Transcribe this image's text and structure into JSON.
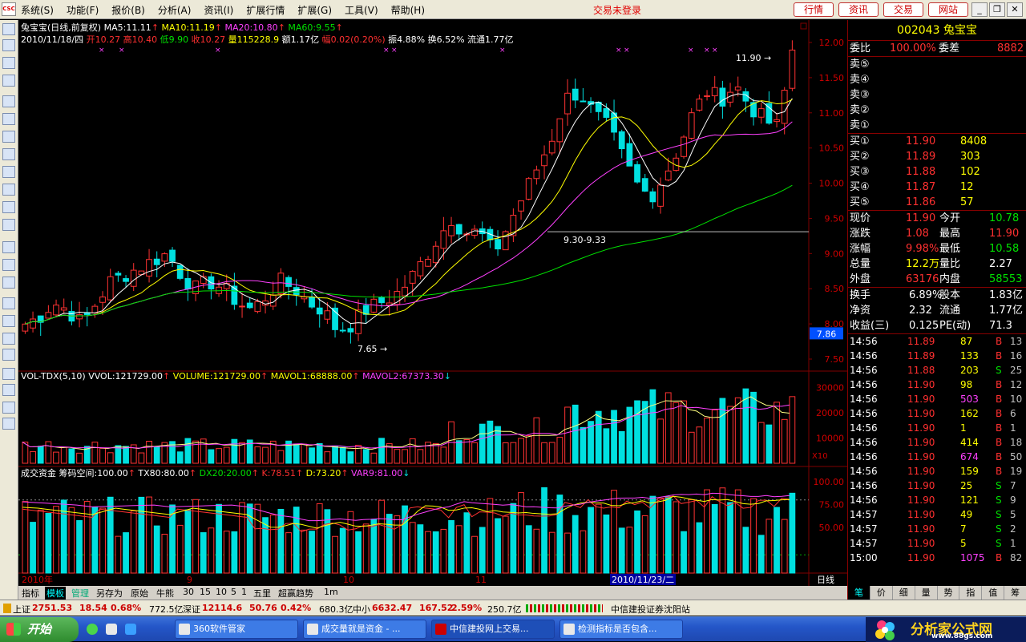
{
  "menubar": {
    "logo": "CSC",
    "items": [
      "系统(S)",
      "功能(F)",
      "报价(B)",
      "分析(A)",
      "资讯(I)",
      "扩展行情",
      "扩展(G)",
      "工具(V)",
      "帮助(H)"
    ],
    "center_text": "交易未登录",
    "buttons": [
      "行情",
      "资讯",
      "交易",
      "网站"
    ]
  },
  "main_chart": {
    "info_line1": {
      "stock": "兔宝宝(日线,前复权)",
      "ma5": "MA5:11.11",
      "ma10": "MA10:11.19",
      "ma20": "MA20:10.80",
      "ma60": "MA60:9.55"
    },
    "info_line2": {
      "date": "2010/11/18/四",
      "open": "开10.27",
      "high": "高10.40",
      "low": "低9.90",
      "close": "收10.27",
      "vol": "量115228.9",
      "amt": "额1.17亿",
      "chg": "幅0.02(0.20%)",
      "amp": "振4.88%",
      "turn": "换6.52%",
      "float": "流通1.77亿"
    },
    "annotations": {
      "high_label": "11.90",
      "low_label": "7.65",
      "line_label": "9.30-9.33",
      "price_tag": "7.86"
    },
    "y_labels": [
      "12.00",
      "11.50",
      "11.00",
      "10.50",
      "10.00",
      "9.50",
      "9.00",
      "8.50",
      "8.00",
      "7.50"
    ]
  },
  "vol_panel": {
    "title": "VOL-TDX(5,10)",
    "vvol": "VVOL:121729.00",
    "volume": "VOLUME:121729.00",
    "mavol1": "MAVOL1:68888.00",
    "mavol2": "MAVOL2:67373.30",
    "y_labels": [
      "30000",
      "20000",
      "10000"
    ],
    "scale": "X10"
  },
  "ind_panel": {
    "title": "成交资金",
    "p1": "筹码空间:100.00",
    "tx": "TX80:80.00",
    "dx": "DX20:20.00",
    "k": "K:78.51",
    "d": "D:73.20",
    "var9": "VAR9:81.00",
    "y_labels": [
      "100.00",
      "75.00",
      "50.00"
    ]
  },
  "x_axis": {
    "labels": [
      "2010年",
      "9",
      "10",
      "11"
    ],
    "cursor": "2010/11/23/二",
    "period": "日线"
  },
  "bottom_tabs": [
    "指标",
    "模板",
    "管理",
    "另存为",
    "原始",
    "牛熊",
    "30",
    "15",
    "10",
    "5",
    "1",
    "五里",
    "超赢趋势",
    "1m"
  ],
  "right_panel": {
    "code": "002043",
    "name": "兔宝宝",
    "weibi_label": "委比",
    "weibi": "100.00%",
    "weicha_label": "委差",
    "weicha": "8882",
    "sell": [
      {
        "label": "卖⑤",
        "price": "",
        "vol": ""
      },
      {
        "label": "卖④",
        "price": "",
        "vol": ""
      },
      {
        "label": "卖③",
        "price": "",
        "vol": ""
      },
      {
        "label": "卖②",
        "price": "",
        "vol": ""
      },
      {
        "label": "卖①",
        "price": "",
        "vol": ""
      }
    ],
    "buy": [
      {
        "label": "买①",
        "price": "11.90",
        "vol": "8408"
      },
      {
        "label": "买②",
        "price": "11.89",
        "vol": "303"
      },
      {
        "label": "买③",
        "price": "11.88",
        "vol": "102"
      },
      {
        "label": "买④",
        "price": "11.87",
        "vol": "12"
      },
      {
        "label": "买⑤",
        "price": "11.86",
        "vol": "57"
      }
    ],
    "stats": [
      {
        "l1": "现价",
        "v1": "11.90",
        "l2": "今开",
        "v2": "10.78"
      },
      {
        "l1": "涨跌",
        "v1": "1.08",
        "l2": "最高",
        "v2": "11.90"
      },
      {
        "l1": "涨幅",
        "v1": "9.98%",
        "l2": "最低",
        "v2": "10.58"
      },
      {
        "l1": "总量",
        "v1": "12.2万",
        "l2": "量比",
        "v2": "2.27"
      },
      {
        "l1": "外盘",
        "v1": "63176",
        "l2": "内盘",
        "v2": "58553"
      }
    ],
    "stats2": [
      {
        "l1": "换手",
        "v1": "6.89%",
        "l2": "股本",
        "v2": "1.83亿"
      },
      {
        "l1": "净资",
        "v1": "2.32",
        "l2": "流通",
        "v2": "1.77亿"
      },
      {
        "l1": "收益(三)",
        "v1": "0.125",
        "l2": "PE(动)",
        "v2": "71.3"
      }
    ],
    "ticks": [
      {
        "t": "14:56",
        "p": "11.89",
        "v": "87",
        "bs": "B",
        "n": "13"
      },
      {
        "t": "14:56",
        "p": "11.89",
        "v": "133",
        "bs": "B",
        "n": "16"
      },
      {
        "t": "14:56",
        "p": "11.88",
        "v": "203",
        "bs": "S",
        "n": "25"
      },
      {
        "t": "14:56",
        "p": "11.90",
        "v": "98",
        "bs": "B",
        "n": "12"
      },
      {
        "t": "14:56",
        "p": "11.90",
        "v": "503",
        "bs": "B",
        "n": "10"
      },
      {
        "t": "14:56",
        "p": "11.90",
        "v": "162",
        "bs": "B",
        "n": "6"
      },
      {
        "t": "14:56",
        "p": "11.90",
        "v": "1",
        "bs": "B",
        "n": "1"
      },
      {
        "t": "14:56",
        "p": "11.90",
        "v": "414",
        "bs": "B",
        "n": "18"
      },
      {
        "t": "14:56",
        "p": "11.90",
        "v": "674",
        "bs": "B",
        "n": "50"
      },
      {
        "t": "14:56",
        "p": "11.90",
        "v": "159",
        "bs": "B",
        "n": "19"
      },
      {
        "t": "14:56",
        "p": "11.90",
        "v": "25",
        "bs": "S",
        "n": "7"
      },
      {
        "t": "14:56",
        "p": "11.90",
        "v": "121",
        "bs": "S",
        "n": "9"
      },
      {
        "t": "14:57",
        "p": "11.90",
        "v": "49",
        "bs": "S",
        "n": "5"
      },
      {
        "t": "14:57",
        "p": "11.90",
        "v": "7",
        "bs": "S",
        "n": "2"
      },
      {
        "t": "14:57",
        "p": "11.90",
        "v": "5",
        "bs": "S",
        "n": "1"
      },
      {
        "t": "15:00",
        "p": "11.90",
        "v": "1075",
        "bs": "B",
        "n": "82"
      }
    ],
    "tabs": [
      "笔",
      "价",
      "细",
      "量",
      "势",
      "指",
      "值",
      "筹"
    ]
  },
  "statusbar": {
    "sh_label": "上证",
    "sh": "2751.53",
    "sh_chg": "18.54",
    "sh_pct": "0.68%",
    "sh_amt": "772.5亿",
    "sz_label": "深证",
    "sz": "12114.6",
    "sz_chg": "50.76",
    "sz_pct": "0.42%",
    "sz_amt": "680.3亿",
    "zx_label": "中小",
    "zx": "6632.47",
    "zx_chg": "167.52",
    "zx_pct": "2.59%",
    "zx_amt": "250.7亿",
    "site": "中信建投证券沈阳站"
  },
  "taskbar": {
    "start": "开始",
    "tasks": [
      "360软件管家",
      "成交量就是资金 - ...",
      "中信建投网上交易...",
      "检测指标是否包含..."
    ],
    "brand1": "分析家公式网",
    "brand2": "www.88gs.com"
  }
}
